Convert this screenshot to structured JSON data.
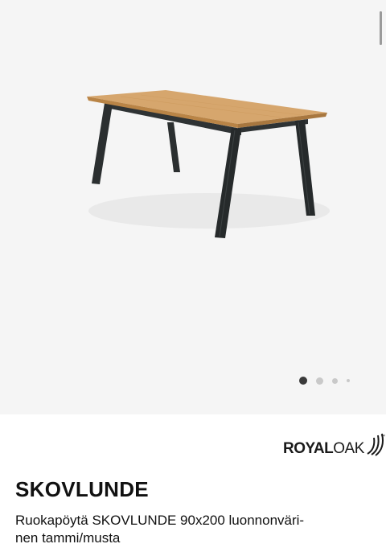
{
  "gallery": {
    "image_subject": "dining table with light oak top and black legs",
    "slide_count": 4,
    "active_slide": 1
  },
  "brand": {
    "royal": "ROYAL",
    "oak": "OAK",
    "tm": "™"
  },
  "product": {
    "name": "SKOVLUNDE",
    "description_line1": "Ruokapöytä SKOVLUNDE 90x200 luonnonväri-",
    "description_line2": "nen tammi/musta"
  }
}
